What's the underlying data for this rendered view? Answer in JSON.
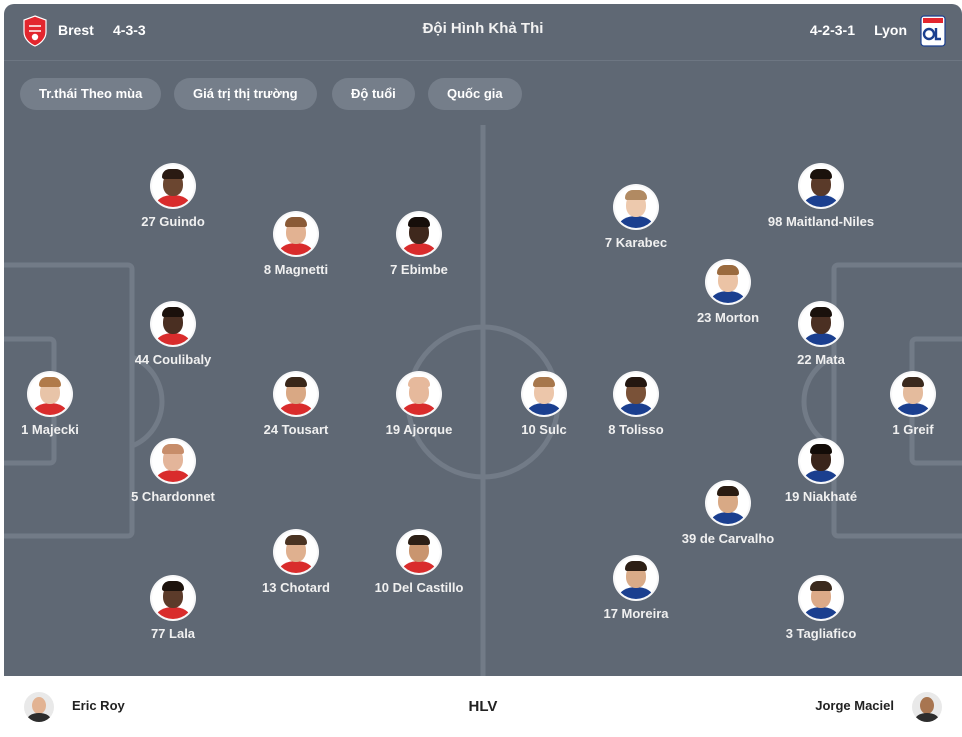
{
  "header": {
    "home_team": "Brest",
    "home_formation": "4-3-3",
    "title": "Đội Hình Khả Thi",
    "away_formation": "4-2-3-1",
    "away_team": "Lyon"
  },
  "filters": [
    "Tr.thái Theo mùa",
    "Giá trị thị trường",
    "Độ tuổi",
    "Quốc gia"
  ],
  "colors": {
    "panel": "#5f6874",
    "chip": "#757e8a",
    "lines": "#727b87",
    "brest_red": "#e3262e",
    "lyon_blue": "#1b3f8f"
  },
  "home_players": [
    {
      "num": "1",
      "name": "Majecki",
      "skin": "#e8c4a8",
      "hair": "#b07a4a",
      "kit": "#d92c2c"
    },
    {
      "num": "27",
      "name": "Guindo",
      "skin": "#6b4630",
      "hair": "#2a1a12",
      "kit": "#d92c2c"
    },
    {
      "num": "44",
      "name": "Coulibaly",
      "skin": "#4a2f22",
      "hair": "#1b110c",
      "kit": "#d92c2c"
    },
    {
      "num": "5",
      "name": "Chardonnet",
      "skin": "#e3b59a",
      "hair": "#c78d6a",
      "kit": "#d92c2c"
    },
    {
      "num": "77",
      "name": "Lala",
      "skin": "#5c3b2a",
      "hair": "#1d130d",
      "kit": "#d92c2c"
    },
    {
      "num": "8",
      "name": "Magnetti",
      "skin": "#e2b292",
      "hair": "#8a5a36",
      "kit": "#d92c2c"
    },
    {
      "num": "24",
      "name": "Tousart",
      "skin": "#d9a884",
      "hair": "#3a2719",
      "kit": "#d92c2c"
    },
    {
      "num": "13",
      "name": "Chotard",
      "skin": "#dfb08f",
      "hair": "#4a3322",
      "kit": "#d92c2c"
    },
    {
      "num": "7",
      "name": "Ebimbe",
      "skin": "#3f281d",
      "hair": "#160e0a",
      "kit": "#d92c2c"
    },
    {
      "num": "19",
      "name": "Ajorque",
      "skin": "#e6b99c",
      "hair": "#e6b99c",
      "kit": "#d92c2c"
    },
    {
      "num": "10",
      "name": "Del Castillo",
      "skin": "#c9956f",
      "hair": "#2b1e15",
      "kit": "#d92c2c"
    }
  ],
  "away_players": [
    {
      "num": "1",
      "name": "Greif",
      "skin": "#e4bb9d",
      "hair": "#3b2a1e",
      "kit": "#1b3f8f"
    },
    {
      "num": "98",
      "name": "Maitland-Niles",
      "skin": "#5a3a29",
      "hair": "#1b120c",
      "kit": "#1b3f8f"
    },
    {
      "num": "22",
      "name": "Mata",
      "skin": "#4b3023",
      "hair": "#1a110c",
      "kit": "#1b3f8f"
    },
    {
      "num": "19",
      "name": "Niakhaté",
      "skin": "#3a251b",
      "hair": "#130c08",
      "kit": "#1b3f8f"
    },
    {
      "num": "3",
      "name": "Tagliafico",
      "skin": "#dcaa88",
      "hair": "#3b2a1d",
      "kit": "#1b3f8f"
    },
    {
      "num": "23",
      "name": "Morton",
      "skin": "#ebc3a5",
      "hair": "#9a6a3e",
      "kit": "#1b3f8f"
    },
    {
      "num": "39",
      "name": "de Carvalho",
      "skin": "#d8a985",
      "hair": "#2a1c12",
      "kit": "#1b3f8f"
    },
    {
      "num": "7",
      "name": "Karabec",
      "skin": "#edc9ad",
      "hair": "#b18a62",
      "kit": "#1b3f8f"
    },
    {
      "num": "8",
      "name": "Tolisso",
      "skin": "#7a5238",
      "hair": "#241710",
      "kit": "#1b3f8f"
    },
    {
      "num": "17",
      "name": "Moreira",
      "skin": "#d9ab88",
      "hair": "#2d1f15",
      "kit": "#1b3f8f"
    },
    {
      "num": "10",
      "name": "Sulc",
      "skin": "#ecc6aa",
      "hair": "#a7774c",
      "kit": "#1b3f8f"
    }
  ],
  "footer": {
    "home_coach": "Eric Roy",
    "label": "HLV",
    "away_coach": "Jorge Maciel"
  }
}
